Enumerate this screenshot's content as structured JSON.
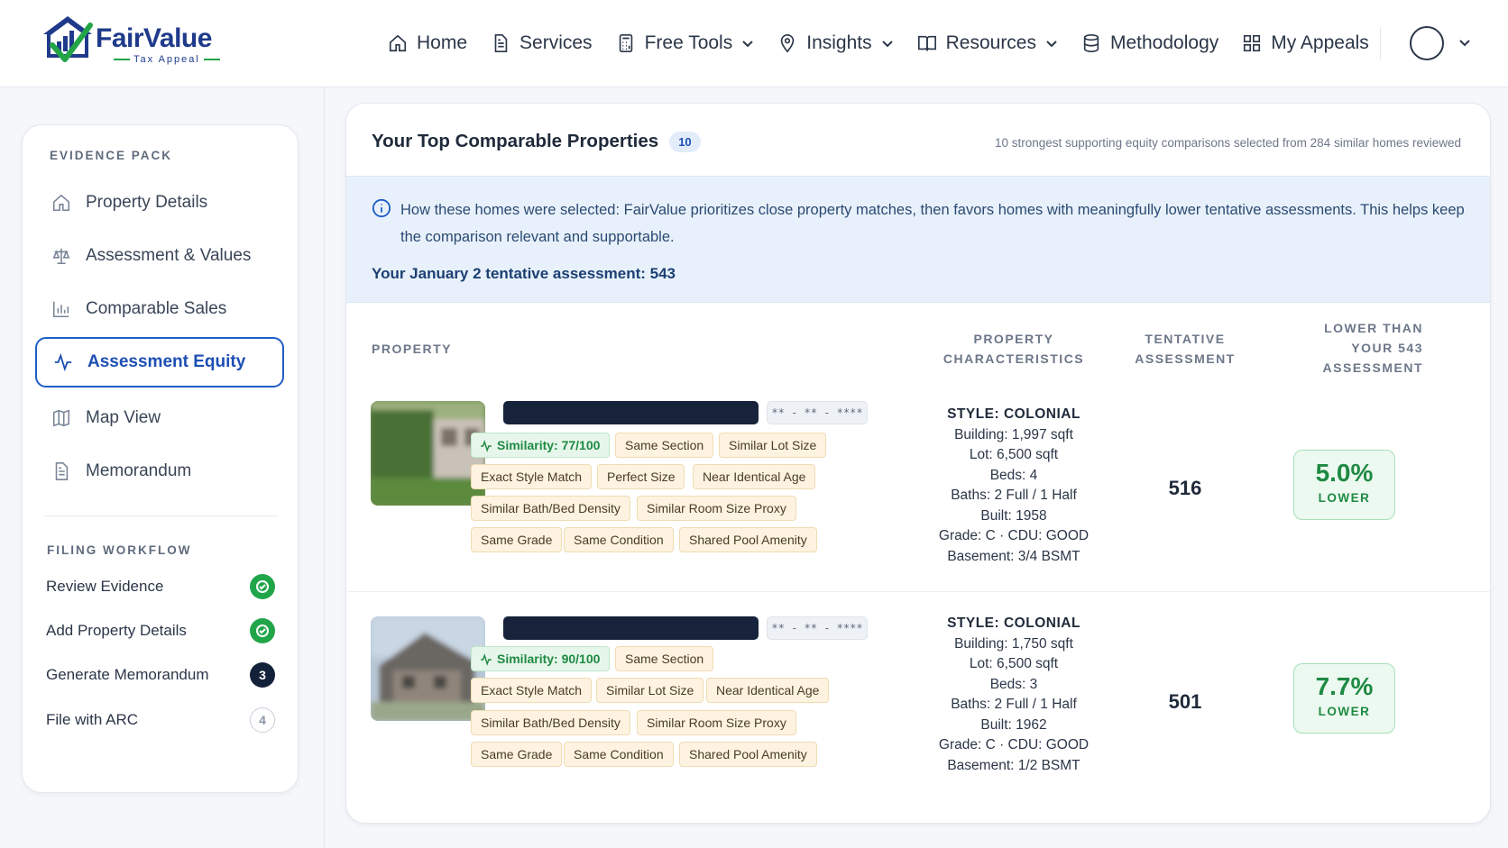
{
  "brand": {
    "name_part1": "Fair",
    "name_part2": "Value",
    "tagline": "Tax Appeal"
  },
  "nav": {
    "items": [
      {
        "label": "Home",
        "icon": "home-icon",
        "dropdown": false
      },
      {
        "label": "Services",
        "icon": "document-icon",
        "dropdown": false
      },
      {
        "label": "Free Tools",
        "icon": "calculator-icon",
        "dropdown": true
      },
      {
        "label": "Insights",
        "icon": "map-pin-icon",
        "dropdown": true
      },
      {
        "label": "Resources",
        "icon": "book-icon",
        "dropdown": true
      },
      {
        "label": "Methodology",
        "icon": "database-icon",
        "dropdown": false
      },
      {
        "label": "My Appeals",
        "icon": "grid-icon",
        "dropdown": false
      }
    ]
  },
  "sidebar": {
    "evidence_heading": "EVIDENCE PACK",
    "items": [
      {
        "label": "Property Details",
        "icon": "home-icon",
        "active": false
      },
      {
        "label": "Assessment & Values",
        "icon": "scale-icon",
        "active": false
      },
      {
        "label": "Comparable Sales",
        "icon": "bar-chart-icon",
        "active": false
      },
      {
        "label": "Assessment Equity",
        "icon": "activity-icon",
        "active": true
      },
      {
        "label": "Map View",
        "icon": "map-icon",
        "active": false
      },
      {
        "label": "Memorandum",
        "icon": "document-icon",
        "active": false
      }
    ],
    "workflow_heading": "FILING WORKFLOW",
    "workflow": [
      {
        "label": "Review Evidence",
        "status": "done",
        "badge": ""
      },
      {
        "label": "Add Property Details",
        "status": "done",
        "badge": ""
      },
      {
        "label": "Generate Memorandum",
        "status": "current",
        "badge": "3"
      },
      {
        "label": "File with ARC",
        "status": "todo",
        "badge": "4"
      }
    ]
  },
  "panel": {
    "title": "Your Top Comparable Properties",
    "count": "10",
    "subtitle": "10 strongest supporting equity comparisons selected from 284 similar homes reviewed",
    "info_text": "How these homes were selected: FairValue prioritizes close property matches, then favors homes with meaningfully lower tentative assessments. This helps keep the comparison relevant and supportable.",
    "info_strong": "Your January 2 tentative assessment: 543",
    "columns": {
      "property": "PROPERTY",
      "characteristics": [
        "PROPERTY",
        "CHARACTERISTICS"
      ],
      "tentative": [
        "TENTATIVE",
        "ASSESSMENT"
      ],
      "lower": [
        "LOWER THAN",
        "YOUR 543",
        "ASSESSMENT"
      ]
    },
    "rows": [
      {
        "masked_id": "** - ** - ****",
        "similarity": "Similarity: 77/100",
        "tags": [
          "Same Section",
          "Similar Lot Size",
          "Exact Style Match",
          "Perfect Size",
          "Near Identical Age",
          "Similar Bath/Bed Density",
          "Similar Room Size Proxy",
          "Same Grade",
          "Same Condition",
          "Shared Pool Amenity"
        ],
        "style": "STYLE: COLONIAL",
        "details": [
          "Building: 1,997 sqft",
          "Lot: 6,500 sqft",
          "Beds: 4",
          "Baths: 2 Full / 1 Half",
          "Built: 1958",
          "Grade: C · CDU: GOOD",
          "Basement: 3/4 BSMT"
        ],
        "assessment": "516",
        "pct": "5.0%",
        "pct_label": "LOWER"
      },
      {
        "masked_id": "** - ** - ****",
        "similarity": "Similarity: 90/100",
        "tags": [
          "Same Section",
          "Exact Style Match",
          "Similar Lot Size",
          "Near Identical Age",
          "Similar Bath/Bed Density",
          "Similar Room Size Proxy",
          "Same Grade",
          "Same Condition",
          "Shared Pool Amenity"
        ],
        "style": "STYLE: COLONIAL",
        "details": [
          "Building: 1,750 sqft",
          "Lot: 6,500 sqft",
          "Beds: 3",
          "Baths: 2 Full / 1 Half",
          "Built: 1962",
          "Grade: C · CDU: GOOD",
          "Basement: 1/2 BSMT"
        ],
        "assessment": "501",
        "pct": "7.7%",
        "pct_label": "LOWER"
      }
    ]
  },
  "colors": {
    "brand_blue": "#1f3a8a",
    "accent_blue": "#1d5dc7",
    "success_green": "#21a54a",
    "tag_bg": "#fdf3e0"
  }
}
